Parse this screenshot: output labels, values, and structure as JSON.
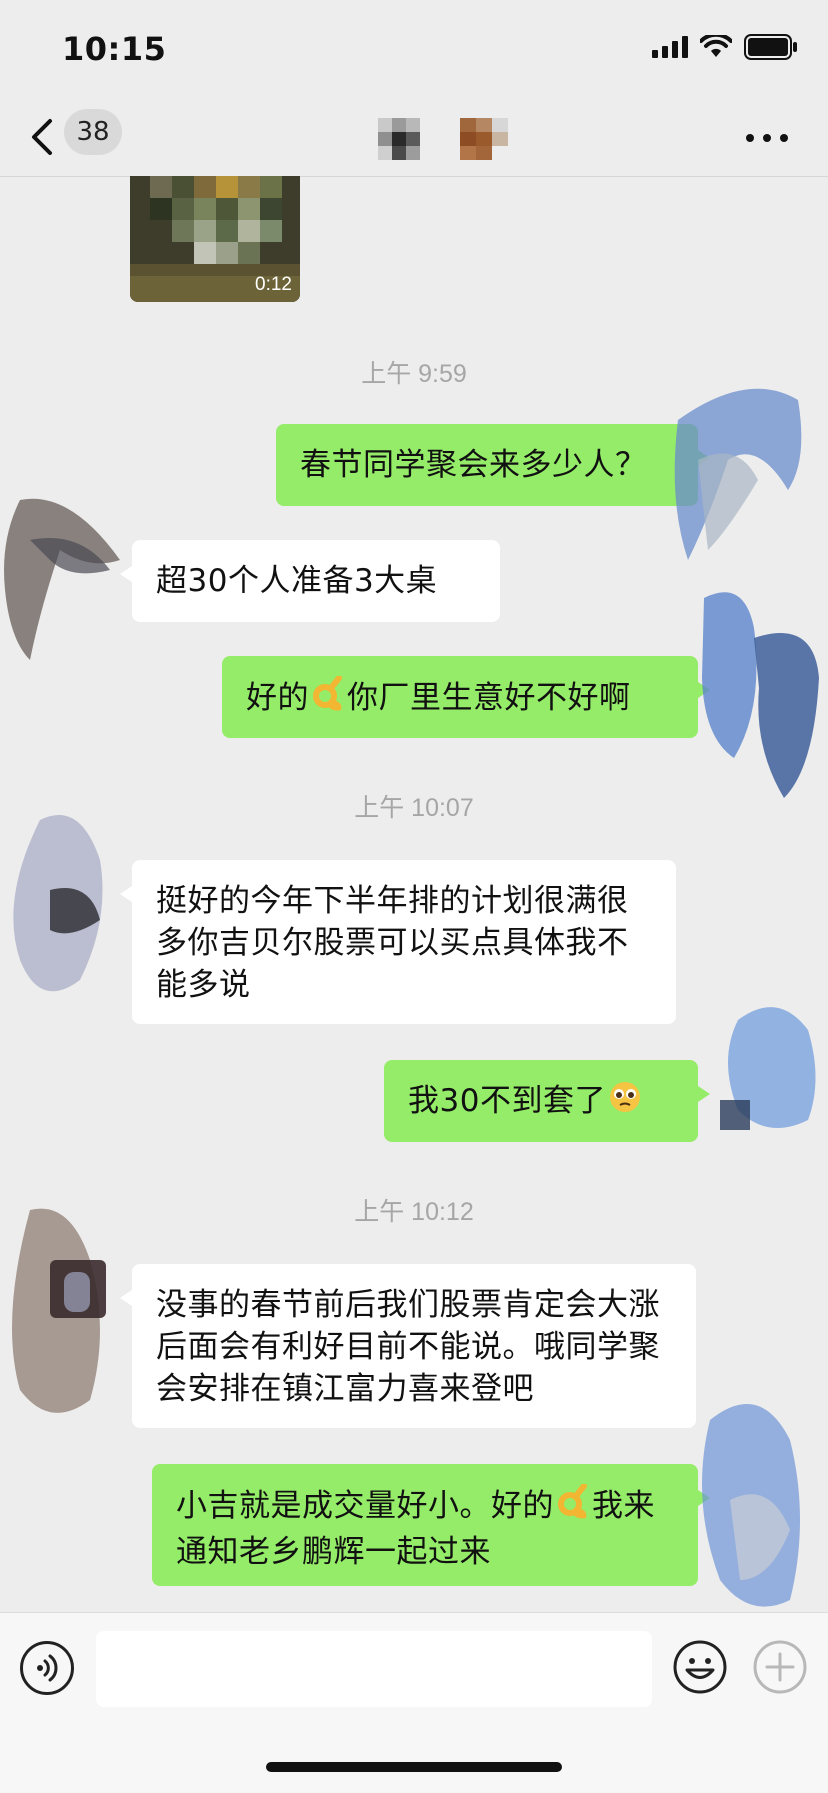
{
  "status_bar": {
    "time": "10:15"
  },
  "nav": {
    "unread_count": "38"
  },
  "video": {
    "duration": "0:12"
  },
  "timestamps": [
    "上午 9:59",
    "上午 10:07",
    "上午 10:12"
  ],
  "messages": [
    {
      "from": "me",
      "text": "春节同学聚会来多少人？"
    },
    {
      "from": "other",
      "text": "超30个人准备3大桌"
    },
    {
      "from": "me",
      "text_before": "好的",
      "emoji": "ok-hand-emoji",
      "text_after": "你厂里生意好不好啊"
    },
    {
      "from": "other",
      "text": "挺好的今年下半年排的计划很满很多你吉贝尔股票可以买点具体我不能多说"
    },
    {
      "from": "me",
      "text": "我30不到套了",
      "emoji": "pleading-face-emoji"
    },
    {
      "from": "other",
      "text": "没事的春节前后我们股票肯定会大涨后面会有利好目前不能说。哦同学聚会安排在镇江富力喜来登吧"
    },
    {
      "from": "me",
      "text_before": "小吉就是成交量好小。好的",
      "emoji": "ok-hand-emoji",
      "text_after": "我来通知老乡鹏辉一起过来"
    }
  ],
  "input": {
    "placeholder": "",
    "value": ""
  },
  "colors": {
    "self_bubble": "#95ec69",
    "other_bubble": "#ffffff",
    "background": "#ededed"
  }
}
